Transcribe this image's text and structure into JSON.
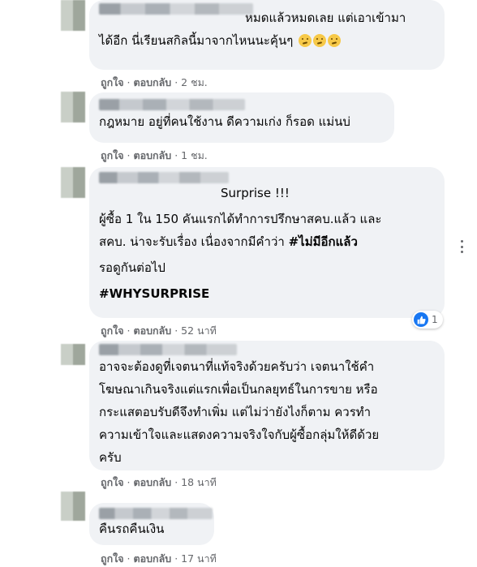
{
  "comments": [
    {
      "lines": [
        "หมดแล้วหมดเลย แต่เอาเข้ามา",
        "ได้อีก นี่เรียนสกิลนี้มาจากไหนนะคุ้นๆ"
      ],
      "emoji": [
        "thinking-emoji",
        "thinking-emoji",
        "thinking-emoji"
      ],
      "like": "ถูกใจ",
      "reply": "ตอบกลับ",
      "time": "2 ชม."
    },
    {
      "lines": [
        "กฎหมาย อยู่ที่คนใช้งาน ดีความเก่ง ก็รอด แม่นบ่"
      ],
      "like": "ถูกใจ",
      "reply": "ตอบกลับ",
      "time": "1 ชม."
    },
    {
      "header_line": "Surprise !!!",
      "lines": [
        "ผู้ซื้อ 1 ใน 150 คันแรกได้ทำการปรึกษาสคบ.แล้ว และ",
        "สคบ. น่าจะรับเรื่อง เนื่องจากมีคำว่า "
      ],
      "bold_tag": "#ไม่มีอีกแล้ว",
      "line_wait": "รอดูกันต่อไป",
      "hashtag": "#WHYSURPRISE",
      "reaction_count": "1",
      "like": "ถูกใจ",
      "reply": "ตอบกลับ",
      "time": "52 นาที"
    },
    {
      "lines": [
        "อาจจะต้องดูที่เจตนาที่แท้จริงด้วยครับว่า เจตนาใช้คำ",
        "โฆษณาเกินจริงแต่แรกเพื่อเป็นกลยุทธ์ในการขาย หรือ",
        "กระแสตอบรับดีจึงทำเพิ่ม แต่ไม่ว่ายังไงก็ตาม ควรทำ",
        "ความเข้าใจและแสดงความจริงใจกับผู้ซื้อกลุ่มให้ดีด้วย",
        "ครับ"
      ],
      "like": "ถูกใจ",
      "reply": "ตอบกลับ",
      "time": "18 นาที"
    },
    {
      "lines": [
        "คืนรถคืนเงิน"
      ],
      "like": "ถูกใจ",
      "reply": "ตอบกลับ",
      "time": "17 นาที"
    }
  ],
  "colors": {
    "bubble": "#f0f2f5",
    "meta": "#65676b",
    "like_blue": "#1877f2"
  }
}
